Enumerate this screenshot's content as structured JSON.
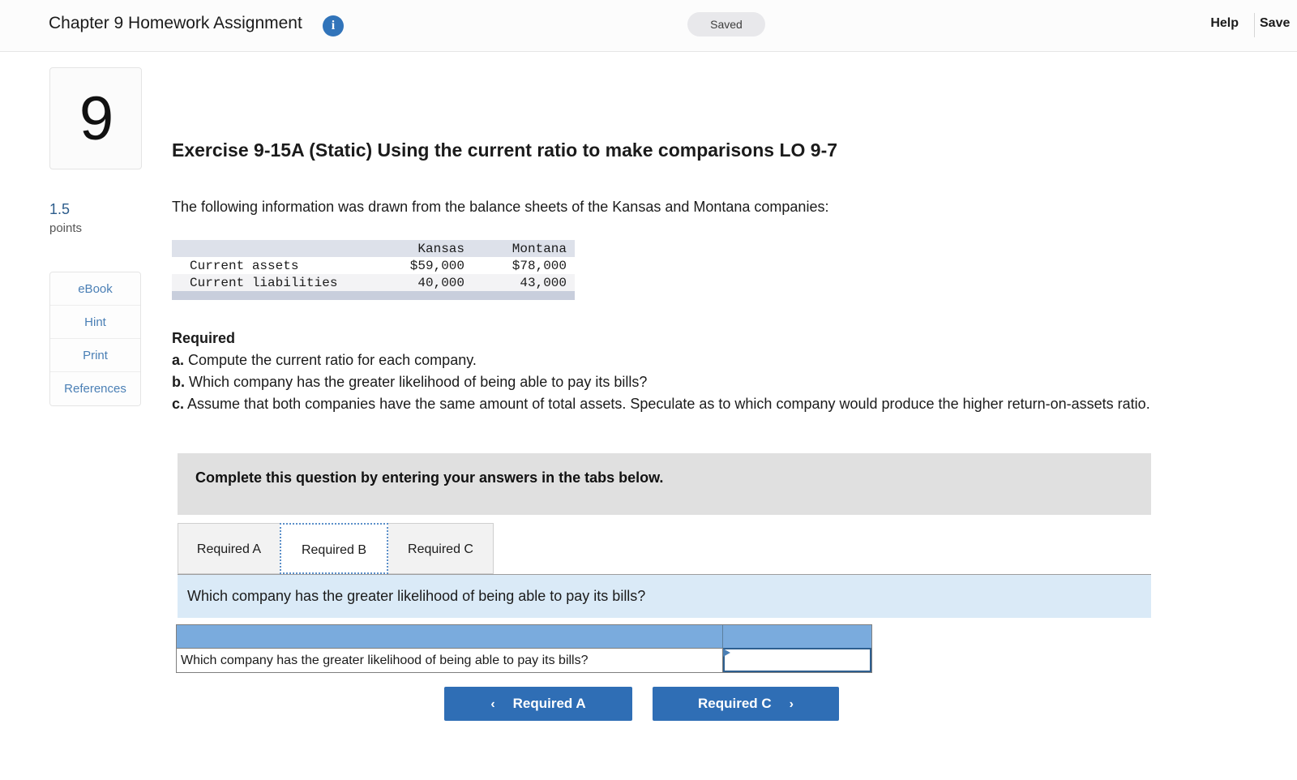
{
  "topbar": {
    "title": "Chapter 9 Homework Assignment",
    "info_icon": "info-icon",
    "saved_badge": "Saved",
    "help_label": "Help",
    "save_exit_label": "Save"
  },
  "rail": {
    "question_number": "9",
    "points_value": "1.5",
    "points_label": "points",
    "buttons": [
      {
        "label": "eBook"
      },
      {
        "label": "Hint"
      },
      {
        "label": "Print"
      },
      {
        "label": "References"
      }
    ]
  },
  "exercise": {
    "title": "Exercise 9-15A (Static) Using the current ratio to make comparisons LO 9-7",
    "intro": "The following information was drawn from the balance sheets of the Kansas and Montana companies:"
  },
  "fin_table": {
    "columns": [
      "",
      "Kansas",
      "Montana"
    ],
    "rows": [
      {
        "label": "Current assets",
        "kansas": "$59,000",
        "montana": "$78,000"
      },
      {
        "label": "Current liabilities",
        "kansas": "40,000",
        "montana": "43,000"
      }
    ]
  },
  "required": {
    "heading": "Required",
    "items": [
      {
        "letter": "a.",
        "text": "Compute the current ratio for each company."
      },
      {
        "letter": "b.",
        "text": "Which company has the greater likelihood of being able to pay its bills?"
      },
      {
        "letter": "c.",
        "text": "Assume that both companies have the same amount of total assets. Speculate as to which company would produce the higher return-on-assets ratio."
      }
    ]
  },
  "instruction_banner": {
    "text": "Complete this question by entering your answers in the tabs below."
  },
  "tabs": [
    {
      "label": "Required A",
      "active": false
    },
    {
      "label": "Required B",
      "active": true
    },
    {
      "label": "Required C",
      "active": false
    }
  ],
  "question_bar": {
    "text": "Which company has the greater likelihood of being able to pay its bills?"
  },
  "answer_grid": {
    "header": [
      "",
      ""
    ],
    "row_label": "Which company has the greater likelihood of being able to pay its bills?",
    "input_value": "",
    "input_placeholder": ""
  },
  "nav": {
    "prev_label": "Required A",
    "prev_chevron": "‹",
    "next_label": "Required C",
    "next_chevron": "›"
  },
  "colors": {
    "accent_blue": "#2f6eb5",
    "grid_header_blue": "#7aabdd",
    "question_bar_blue": "#daeaf7",
    "banner_gray": "#e0e0e0",
    "table_header_gray": "#dde1ea",
    "link_blue": "#4a7fb5"
  }
}
